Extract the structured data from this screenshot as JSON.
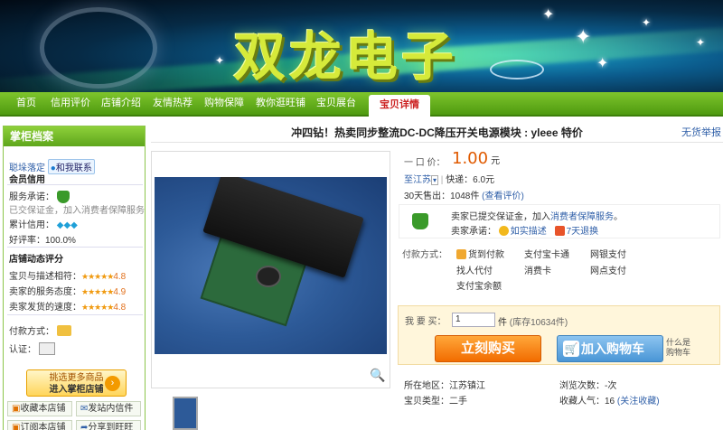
{
  "banner": {
    "title": "双龙电子"
  },
  "nav": {
    "items": [
      "首页",
      "信用评价",
      "店铺介绍",
      "友情热荐",
      "购物保障",
      "教你逛旺铺",
      "宝贝展台"
    ],
    "active": "宝贝详情"
  },
  "sidebar": {
    "header": "掌柜档案",
    "seller_name": "聪垛落定",
    "contact": "和我联系",
    "credit_title": "会员信用",
    "service_label": "服务承诺：",
    "deposit_note": "已交保证金，加入消费者保障服务",
    "credit_label": "累计信用：",
    "credit_diamonds": "◆◆◆",
    "rating_label": "好评率：100.0%",
    "dynamic_title": "店铺动态评分",
    "ratings": [
      {
        "label": "宝贝与描述相符：",
        "stars": "★★★★★",
        "score": "4.8"
      },
      {
        "label": "卖家的服务态度：",
        "stars": "★★★★★",
        "score": "4.9"
      },
      {
        "label": "卖家发货的速度：",
        "stars": "★★★★★",
        "score": "4.8"
      }
    ],
    "payment_label": "付款方式：",
    "auth_label": "认证：",
    "enter_top": "挑选更多商品",
    "enter_bottom": "进入掌柜店铺",
    "buttons": [
      "收藏本店铺",
      "发站内信件",
      "订阅本店铺",
      "分享到旺旺"
    ]
  },
  "product": {
    "title": "冲四钻！热卖同步整流DC-DC降压开关电源模块 : yleee 特价",
    "report": "无货举报",
    "price_label": "一 口 价：",
    "price": "1.00",
    "price_unit": "元",
    "ship_from": "至江苏",
    "ship_sep": "|",
    "ship_method": "快递：6.0元",
    "sold_label": "30天售出：",
    "sold_count": "1048件",
    "sold_link": "(查看评价)",
    "guarantee_text_a": "卖家已提交保证金，加入",
    "guarantee_link": "消费者保障服务",
    "guarantee_text_b": "。",
    "promise_label": "卖家承诺：",
    "promise_1": "如实描述",
    "promise_2": "7天退换",
    "payment_label": "付款方式：",
    "payments": [
      "货到付款",
      "支付宝卡通",
      "网银支付",
      "找人代付",
      "消费卡",
      "网点支付",
      "支付宝余额"
    ],
    "qty_label": "我 要 买：",
    "qty_value": "1",
    "qty_unit": "件",
    "stock": "(库存10634件)",
    "buy_now": "立刻购买",
    "add_cart": "加入购物车",
    "what_is": "什么是",
    "what_is_2": "购物车",
    "location_label": "所在地区：",
    "location": "江苏镇江",
    "views_label": "浏览次数：",
    "views": "-次",
    "type_label": "宝贝类型：",
    "type": "二手",
    "fav_label": "收藏人气：",
    "fav_count": "16",
    "fav_link": "(关注收藏)"
  },
  "colors": {
    "nav_green": "#5ea61c",
    "price_orange": "#e05a00",
    "link_blue": "#2f5fa8"
  }
}
